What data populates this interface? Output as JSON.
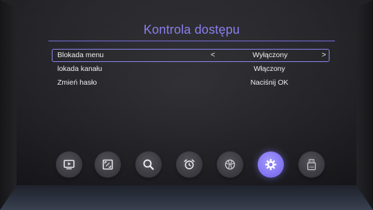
{
  "menu": {
    "title": "Kontrola dostępu",
    "rows": [
      {
        "label": "Blokada menu",
        "value": "Wyłączony",
        "selected": true
      },
      {
        "label": "lokada kanału",
        "value": "Włączony",
        "selected": false
      },
      {
        "label": "Zmień hasło",
        "value": "Naciśnij OK",
        "selected": false
      }
    ],
    "arrow_left": "<",
    "arrow_right": ">"
  },
  "dock": {
    "items": [
      {
        "icon": "tv-play-icon",
        "active": false
      },
      {
        "icon": "picture-frame-icon",
        "active": false
      },
      {
        "icon": "search-icon",
        "active": false
      },
      {
        "icon": "alarm-clock-icon",
        "active": false
      },
      {
        "icon": "ball-icon",
        "active": false
      },
      {
        "icon": "gear-icon",
        "active": true
      },
      {
        "icon": "usb-icon",
        "active": false
      }
    ],
    "usb_label": "USB"
  },
  "colors": {
    "accent": "#8a7ff0",
    "active_button": "#8376f2",
    "text": "#f0f0f0",
    "background": "#262629"
  }
}
